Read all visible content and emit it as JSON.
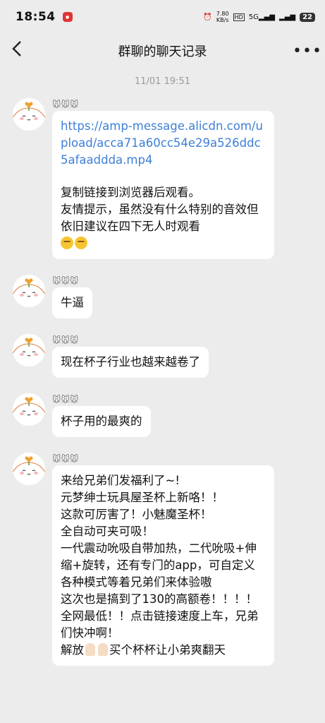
{
  "status": {
    "time": "18:54",
    "app_badge": "小红书",
    "speed_value": "7.80",
    "speed_unit": "KB/s",
    "network": "5G",
    "battery": "22"
  },
  "nav": {
    "title": "群聊的聊天记录"
  },
  "timestamp": "11/01 19:51",
  "messages": [
    {
      "sender": "🐭🐭🐭",
      "link": "https://amp-message.alicdn.com/upload/acca71a60cc54e29a526ddc5afaaddda.mp4",
      "line1": "复制链接到浏览器后观看。",
      "line2": "友情提示，虽然没有什么特别的音效但依旧建议在四下无人时观看"
    },
    {
      "sender": "🐭🐭🐭",
      "text": "牛逼"
    },
    {
      "sender": "🐭🐭🐭",
      "text": "现在杯子行业也越来越卷了"
    },
    {
      "sender": "🐭🐭🐭",
      "text": "杯子用的最爽的"
    },
    {
      "sender": "🐭🐭🐭",
      "lines": [
        "来给兄弟们发福利了~!",
        "元梦绅士玩具屋圣杯上新咯！！",
        "这款可厉害了！小魅魔圣杯！",
        "全自动可夹可吸！",
        "一代震动吮吸自带加热，二代吮吸+伸缩+旋转，还有专门的app，可自定义各种模式等着兄弟们来体验嗷",
        "这次也是搞到了130的高额卷！！！！全网最低！！点击链接速度上车，兄弟们快冲啊！"
      ],
      "last_a": "解放",
      "last_b": "买个杯杯让小弟爽翻天"
    }
  ]
}
